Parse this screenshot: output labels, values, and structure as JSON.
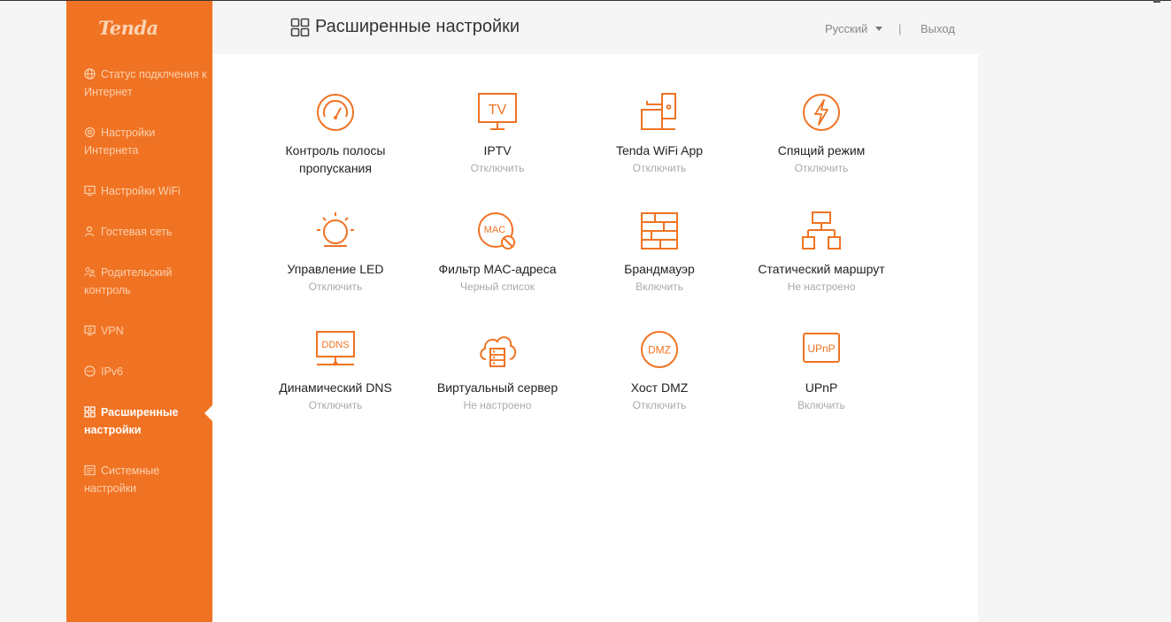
{
  "brand": {
    "logo_text": "Tenda",
    "accent": "#f07323"
  },
  "sidebar": {
    "items": [
      {
        "label": "Статус подклчения к Интернет",
        "icon": "globe-icon",
        "active": false
      },
      {
        "label": "Настройки Интернета",
        "icon": "network-icon",
        "active": false
      },
      {
        "label": "Настройки WiFi",
        "icon": "wifi-settings-icon",
        "active": false
      },
      {
        "label": "Гостевая сеть",
        "icon": "guest-user-icon",
        "active": false
      },
      {
        "label": "Родительский контроль",
        "icon": "parental-icon",
        "active": false
      },
      {
        "label": "VPN",
        "icon": "vpn-icon",
        "active": false
      },
      {
        "label": "IPv6",
        "icon": "ipv6-icon",
        "active": false
      },
      {
        "label": "Расширенные настройки",
        "icon": "grid-icon",
        "active": true
      },
      {
        "label": "Системные настройки",
        "icon": "system-icon",
        "active": false
      }
    ]
  },
  "header": {
    "title": "Расширенные настройки",
    "language": "Русский",
    "separator": "|",
    "logout": "Выход"
  },
  "tiles": [
    {
      "name": "Контроль полосы пропускания",
      "status": "",
      "icon": "speedometer-icon"
    },
    {
      "name": "IPTV",
      "status": "Отключить",
      "icon": "tv-icon"
    },
    {
      "name": "Tenda WiFi App",
      "status": "Отключить",
      "icon": "app-device-icon"
    },
    {
      "name": "Спящий режим",
      "status": "Отключить",
      "icon": "power-bolt-icon"
    },
    {
      "name": "Управление LED",
      "status": "Отключить",
      "icon": "led-bulb-icon"
    },
    {
      "name": "Фильтр MAC-адреса",
      "status": "Черный список",
      "icon": "mac-filter-icon"
    },
    {
      "name": "Брандмауэр",
      "status": "Включить",
      "icon": "firewall-icon"
    },
    {
      "name": "Статический маршрут",
      "status": "Не настроено",
      "icon": "static-route-icon"
    },
    {
      "name": "Динамический DNS",
      "status": "Отключить",
      "icon": "ddns-icon"
    },
    {
      "name": "Виртуальный сервер",
      "status": "Не настроено",
      "icon": "cloud-server-icon"
    },
    {
      "name": "Хост DMZ",
      "status": "Отключить",
      "icon": "dmz-icon"
    },
    {
      "name": "UPnP",
      "status": "Включить",
      "icon": "upnp-icon"
    }
  ],
  "icon_texts": {
    "tv": "TV",
    "mac": "MAC",
    "ddns": "DDNS",
    "dmz": "DMZ",
    "upnp": "UPnP"
  }
}
